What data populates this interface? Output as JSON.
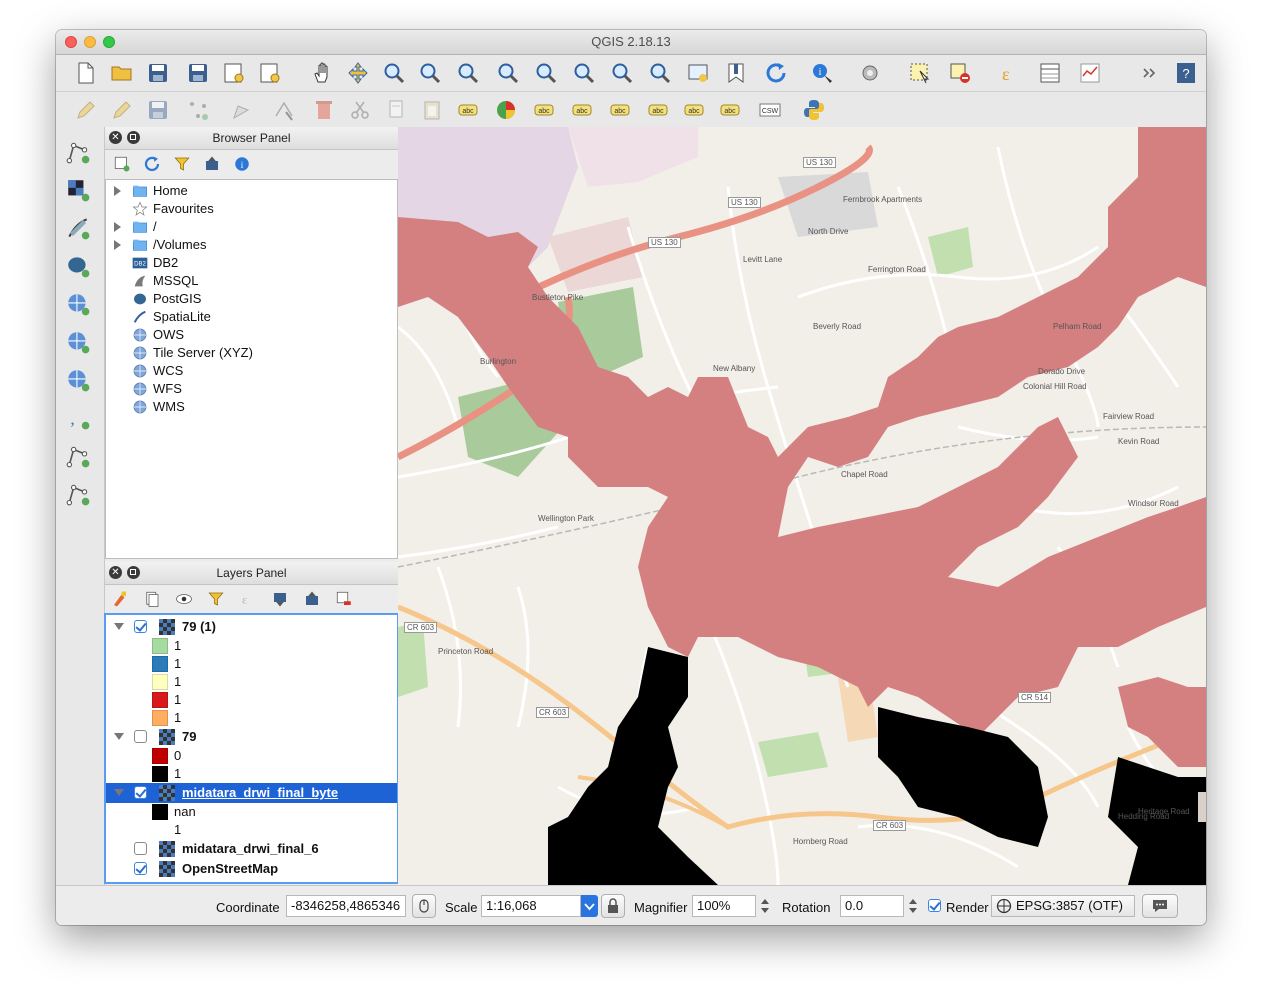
{
  "window": {
    "title": "QGIS 2.18.13"
  },
  "browser_panel": {
    "title": "Browser Panel",
    "items": [
      {
        "label": "Home",
        "expandable": true,
        "icon": "folder-icon"
      },
      {
        "label": "Favourites",
        "expandable": false,
        "icon": "star-icon"
      },
      {
        "label": "/",
        "expandable": true,
        "icon": "folder-icon"
      },
      {
        "label": "/Volumes",
        "expandable": true,
        "icon": "folder-icon"
      },
      {
        "label": "DB2",
        "expandable": false,
        "icon": "db2-icon"
      },
      {
        "label": "MSSQL",
        "expandable": false,
        "icon": "mssql-icon"
      },
      {
        "label": "PostGIS",
        "expandable": false,
        "icon": "postgis-icon"
      },
      {
        "label": "SpatiaLite",
        "expandable": false,
        "icon": "spatialite-icon"
      },
      {
        "label": "OWS",
        "expandable": false,
        "icon": "globe-icon"
      },
      {
        "label": "Tile Server (XYZ)",
        "expandable": false,
        "icon": "globe-icon"
      },
      {
        "label": "WCS",
        "expandable": false,
        "icon": "globe-icon"
      },
      {
        "label": "WFS",
        "expandable": false,
        "icon": "globe-icon"
      },
      {
        "label": "WMS",
        "expandable": false,
        "icon": "globe-icon"
      }
    ]
  },
  "layers_panel": {
    "title": "Layers Panel",
    "layers": [
      {
        "name": "79 (1)",
        "checked": true,
        "expanded": true,
        "selected": false,
        "legend": [
          {
            "label": "1",
            "color": "#a6dba0"
          },
          {
            "label": "1",
            "color": "#2b7bba"
          },
          {
            "label": "1",
            "color": "#ffffbf"
          },
          {
            "label": "1",
            "color": "#d7191c"
          },
          {
            "label": "1",
            "color": "#fdae61"
          }
        ]
      },
      {
        "name": "79",
        "checked": false,
        "expanded": true,
        "selected": false,
        "legend": [
          {
            "label": "0",
            "color": "#c00000"
          },
          {
            "label": "1",
            "color": "#000000"
          }
        ]
      },
      {
        "name": "midatara_drwi_final_byte",
        "checked": true,
        "expanded": true,
        "selected": true,
        "legend": [
          {
            "label": "nan",
            "color": "#000000"
          },
          {
            "label": "1",
            "color": ""
          }
        ]
      },
      {
        "name": "midatara_drwi_final_6",
        "checked": false,
        "expanded": false,
        "selected": false,
        "legend": []
      },
      {
        "name": "OpenStreetMap",
        "checked": true,
        "expanded": false,
        "selected": false,
        "legend": []
      }
    ]
  },
  "map": {
    "labels": [
      "US 130",
      "US 130",
      "US 130",
      "Fernbrook Apartments",
      "New Albany",
      "Wellington Park",
      "CR 603",
      "CR 603",
      "CR 514",
      "CR 603",
      "Burlington",
      "Princeton Road",
      "Hornberg Road",
      "Fairview Road",
      "Chapel Road",
      "Bustleton Pike",
      "Hedding Road",
      "Levitt Lane",
      "North Drive",
      "Ferrington Road",
      "Beverly Road",
      "Pelham Road",
      "Dorado Drive",
      "Colonial Hill Road",
      "Kevin Road",
      "Windsor Road",
      "Heritage Road"
    ],
    "colors": {
      "base": "#f2efe9",
      "flood": "#d58080",
      "nodata": "#000000",
      "park": "#c2dfb0",
      "wood": "#a9cb9b",
      "road": "#ffffff",
      "major_road": "#f6c68b",
      "highway": "#e99283",
      "industrial": "#e0cfe0"
    }
  },
  "status": {
    "coordinate_label": "Coordinate",
    "coordinate_value": "-8346258,4865346",
    "scale_label": "Scale",
    "scale_value": "1:16,068",
    "magnifier_label": "Magnifier",
    "magnifier_value": "100%",
    "rotation_label": "Rotation",
    "rotation_value": "0.0",
    "render_label": "Render",
    "render_checked": true,
    "crs_label": "EPSG:3857 (OTF)"
  },
  "toolbar_icons": [
    "new-project-icon",
    "open-project-icon",
    "save-project-icon",
    "save-as-icon",
    "new-print-composer-icon",
    "composer-manager-icon",
    "pan-icon",
    "pan-to-selection-icon",
    "zoom-in-icon",
    "zoom-out-icon",
    "zoom-actual-icon",
    "zoom-full-icon",
    "zoom-to-selection-icon",
    "zoom-to-layer-icon",
    "zoom-last-icon",
    "zoom-next-icon",
    "new-map-view-icon",
    "new-bookmark-icon",
    "refresh-icon",
    "identify-icon",
    "run-action-icon",
    "select-features-icon",
    "deselect-icon",
    "field-calculator-icon",
    "attribute-table-icon",
    "statistics-icon",
    "toolbar-overflow-icon",
    "help-icon"
  ],
  "toolbar2_icons": [
    "current-edits-icon",
    "toggle-editing-icon",
    "save-edits-icon",
    "add-feature-icon",
    "move-feature-icon",
    "node-tool-icon",
    "delete-selected-icon",
    "cut-features-icon",
    "copy-features-icon",
    "paste-features-icon",
    "label-tool-icon",
    "diagram-icon",
    "layer-labeling-icon",
    "pin-labels-icon",
    "show-hide-labels-icon",
    "move-label-icon",
    "rotate-label-icon",
    "change-label-icon",
    "csw-icon",
    "python-console-icon"
  ],
  "side_tools": [
    "add-vector-layer-icon",
    "add-raster-layer-icon",
    "add-spatialite-layer-icon",
    "add-postgis-layer-icon",
    "add-wms-layer-icon",
    "add-wcs-layer-icon",
    "add-wfs-layer-icon",
    "add-delimited-text-icon",
    "add-virtual-layer-icon",
    "new-shapefile-icon"
  ]
}
